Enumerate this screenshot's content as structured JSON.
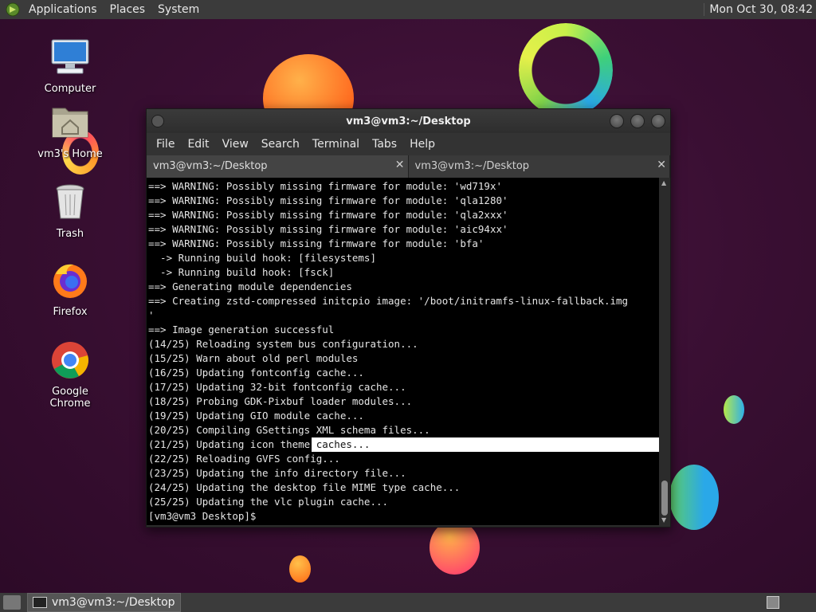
{
  "top_panel": {
    "menus": [
      "Applications",
      "Places",
      "System"
    ],
    "clock": "Mon Oct 30, 08:42"
  },
  "desktop_icons": [
    {
      "label": "Computer",
      "icon": "computer-icon"
    },
    {
      "label": "vm3's Home",
      "icon": "home-folder-icon"
    },
    {
      "label": "Trash",
      "icon": "trash-icon"
    },
    {
      "label": "Firefox",
      "icon": "firefox-icon"
    },
    {
      "label": "Google Chrome",
      "icon": "chrome-icon"
    }
  ],
  "terminal": {
    "title": "vm3@vm3:~/Desktop",
    "menu": [
      "File",
      "Edit",
      "View",
      "Search",
      "Terminal",
      "Tabs",
      "Help"
    ],
    "tabs": [
      {
        "label": "vm3@vm3:~/Desktop",
        "active": true
      },
      {
        "label": "vm3@vm3:~/Desktop",
        "active": false
      }
    ],
    "lines": [
      "==> WARNING: Possibly missing firmware for module: 'wd719x'",
      "==> WARNING: Possibly missing firmware for module: 'qla1280'",
      "==> WARNING: Possibly missing firmware for module: 'qla2xxx'",
      "==> WARNING: Possibly missing firmware for module: 'aic94xx'",
      "==> WARNING: Possibly missing firmware for module: 'bfa'",
      "  -> Running build hook: [filesystems]",
      "  -> Running build hook: [fsck]",
      "==> Generating module dependencies",
      "==> Creating zstd-compressed initcpio image: '/boot/initramfs-linux-fallback.img",
      "'",
      "==> Image generation successful",
      "(14/25) Reloading system bus configuration...",
      "(15/25) Warn about old perl modules",
      "(16/25) Updating fontconfig cache...",
      "(17/25) Updating 32-bit fontconfig cache...",
      "(18/25) Probing GDK-Pixbuf loader modules...",
      "(19/25) Updating GIO module cache...",
      "(20/25) Compiling GSettings XML schema files...",
      "(21/25) Updating icon theme caches...",
      "(22/25) Reloading GVFS config...",
      "(23/25) Updating the info directory file...",
      "(24/25) Updating the desktop file MIME type cache...",
      "(25/25) Updating the vlc plugin cache...",
      "[vm3@vm3 Desktop]$ "
    ],
    "selected_line_index": 18
  },
  "taskbar": {
    "window_label": "vm3@vm3:~/Desktop"
  }
}
